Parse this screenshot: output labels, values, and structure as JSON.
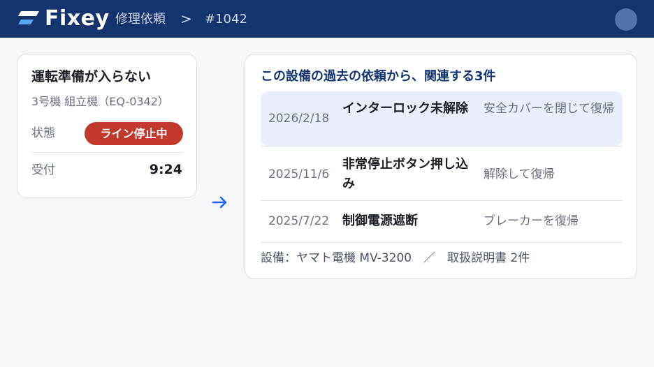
{
  "header": {
    "app_name": "Fixey",
    "breadcrumb": [
      "修理依頼",
      ">",
      "#1042"
    ]
  },
  "request": {
    "title": "運転準備が入らない",
    "machine": "3号機 組立機（EQ-0342）",
    "status_label": "状態",
    "status_value": "ライン停止中",
    "received_label": "受付",
    "received_time": "9:24"
  },
  "history": {
    "title": "この設備の過去の依頼から、関連する3件",
    "rows": [
      {
        "date": "2026/2/18",
        "issue": "インターロック未解除",
        "fix": "安全カバーを閉じて復帰"
      },
      {
        "date": "2025/11/6",
        "issue": "非常停止ボタン押し込み",
        "fix": "解除して復帰"
      },
      {
        "date": "2025/7/22",
        "issue": "制御電源遮断",
        "fix": "ブレーカーを復帰"
      }
    ],
    "footer": "設備：ヤマト電機 MV-3200　／　取扱説明書 2件"
  },
  "colors": {
    "header_bg": "#15346f",
    "status_badge": "#c0392b",
    "accent": "#2563eb",
    "highlight_row": "#e9eefa"
  }
}
